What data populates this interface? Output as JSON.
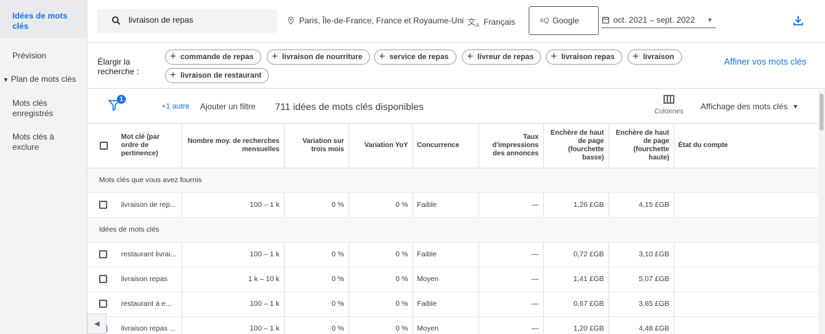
{
  "sidebar": {
    "items": [
      {
        "label": "Idées de mots clés"
      },
      {
        "label": "Prévision"
      },
      {
        "label": "Plan de mots clés"
      },
      {
        "label": "Mots clés enregistrés"
      },
      {
        "label": "Mots clés à exclure"
      }
    ]
  },
  "topbar": {
    "search_value": "livraison de repas",
    "location": "Paris, Île-de-France, France et Royaume-Uni",
    "language": "Français",
    "network": "Google",
    "date_range": "oct. 2021 – sept. 2022"
  },
  "expand": {
    "label": "Élargir la recherche :",
    "chips": [
      "commande de repas",
      "livraison de nourriture",
      "service de repas",
      "livreur de repas",
      "livraison repas",
      "livraison",
      "livraison de restaurant"
    ],
    "refine_label": "Affiner vos mots clés"
  },
  "toolbar": {
    "filter_badge": "1",
    "more_link": "+1 autre",
    "add_filter": "Ajouter un filtre",
    "ideas_count": "711 idées de mots clés disponibles",
    "columns_label": "Colonnes",
    "view_label": "Affichage des mots clés"
  },
  "table": {
    "headers": [
      "Mot clé (par ordre de pertinence)",
      "Nombre moy. de recherches mensuelles",
      "Variation sur trois mois",
      "Variation YoY",
      "Concurrence",
      "Taux d'impressions des annonces",
      "Enchère de haut de page (fourchette basse)",
      "Enchère de haut de page (fourchette haute)",
      "État du compte"
    ],
    "section_provided": "Mots clés que vous avez fournis",
    "section_ideas": "Idées de mots clés",
    "provided_rows": [
      [
        "livraison de rep...",
        "100 – 1 k",
        "0 %",
        "0 %",
        "Faible",
        "—",
        "1,26 £GB",
        "4,15 £GB",
        ""
      ]
    ],
    "idea_rows": [
      [
        "restaurant livrai...",
        "100 – 1 k",
        "0 %",
        "0 %",
        "Faible",
        "—",
        "0,72 £GB",
        "3,10 £GB",
        ""
      ],
      [
        "livraison repas",
        "1 k – 10 k",
        "0 %",
        "0 %",
        "Moyen",
        "—",
        "1,41 £GB",
        "5,07 £GB",
        ""
      ],
      [
        "restaurant à e...",
        "100 – 1 k",
        "0 %",
        "0 %",
        "Faible",
        "—",
        "0,67 £GB",
        "3,65 £GB",
        ""
      ],
      [
        "livraison repas ...",
        "100 – 1 k",
        "0 %",
        "0 %",
        "Moyen",
        "—",
        "1,20 £GB",
        "4,48 £GB",
        ""
      ]
    ]
  },
  "colors": {
    "accent": "#1a73e8",
    "sidebar_bg": "#f1f3f4",
    "text": "#3c4043"
  }
}
